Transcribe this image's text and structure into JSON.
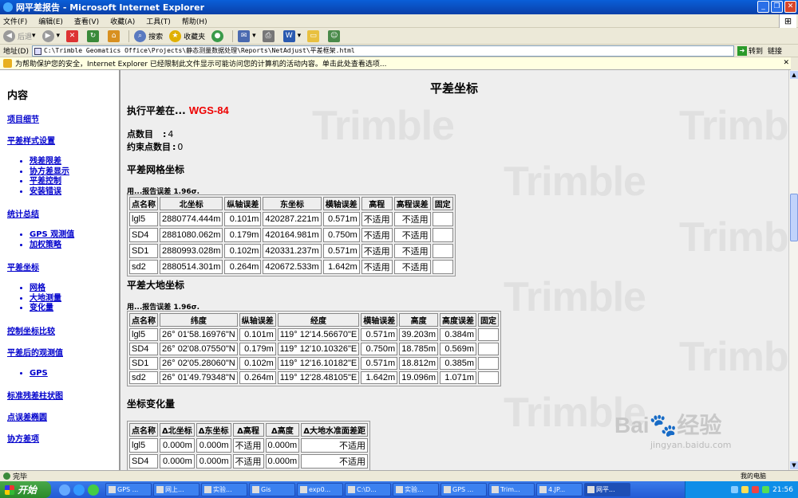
{
  "window": {
    "title": "网平差报告 - Microsoft Internet Explorer",
    "controls": {
      "minimize": "_",
      "maximize": "❐",
      "close": "✕"
    }
  },
  "menu": [
    "文件(F)",
    "编辑(E)",
    "查看(V)",
    "收藏(A)",
    "工具(T)",
    "帮助(H)"
  ],
  "toolbar": {
    "back": "后退",
    "forward": "",
    "search": "搜索",
    "favorites": "收藏夹"
  },
  "address": {
    "label": "地址(D)",
    "url": "C:\\Trimble Geomatics Office\\Projects\\静态测量数据处理\\Reports\\NetAdjust\\平差框架.html",
    "go": "转到",
    "links": "链接"
  },
  "infobar": {
    "text": "为帮助保护您的安全，Internet Explorer 已经限制此文件显示可能访问您的计算机的活动内容。单击此处查看选项..."
  },
  "sidebar": {
    "title": "内容",
    "sections": [
      {
        "label": "项目细节",
        "items": []
      },
      {
        "label": "平差样式设置",
        "items": [
          "残差限差",
          "协方差显示",
          "平差控制",
          "安装错误"
        ]
      },
      {
        "label": "统计总结",
        "items": [
          "GPS 观测值",
          "加权策略"
        ]
      },
      {
        "label": "平差坐标",
        "items": [
          "网格",
          "大地测量",
          "变化量"
        ]
      },
      {
        "label": "控制坐标比较",
        "items": []
      },
      {
        "label": "平差后的观测值",
        "items": [
          "GPS"
        ]
      },
      {
        "label": "标准残差柱状图",
        "items": []
      },
      {
        "label": "点误差椭圆",
        "items": []
      },
      {
        "label": "协方差项",
        "items": []
      }
    ]
  },
  "main": {
    "title": "平差坐标",
    "exec_label": "执行平差在...",
    "exec_datum": "WGS-84",
    "point_count_label": "点数目",
    "point_count": "4",
    "constraint_label": "约束点数目",
    "constraint_count": "0",
    "watermark": "Trimble",
    "grid": {
      "heading": "平差网格坐标",
      "note": "用...报告误差  1.96σ.",
      "columns": [
        "点名称",
        "北坐标",
        "纵轴误差",
        "东坐标",
        "横轴误差",
        "高程",
        "高程误差",
        "固定"
      ],
      "rows": [
        [
          "lgl5",
          "2880774.444m",
          "0.101m",
          "420287.221m",
          "0.571m",
          "不适用",
          "不适用",
          ""
        ],
        [
          "SD4",
          "2881080.062m",
          "0.179m",
          "420164.981m",
          "0.750m",
          "不适用",
          "不适用",
          ""
        ],
        [
          "SD1",
          "2880993.028m",
          "0.102m",
          "420331.237m",
          "0.571m",
          "不适用",
          "不适用",
          ""
        ],
        [
          "sd2",
          "2880514.301m",
          "0.264m",
          "420672.533m",
          "1.642m",
          "不适用",
          "不适用",
          ""
        ]
      ]
    },
    "geodetic": {
      "heading": "平差大地坐标",
      "note": "用...报告误差  1.96σ.",
      "columns": [
        "点名称",
        "纬度",
        "纵轴误差",
        "经度",
        "横轴误差",
        "高度",
        "高度误差",
        "固定"
      ],
      "rows": [
        [
          "lgl5",
          "26°  01'58.16976\"N",
          "0.101m",
          "119°  12'14.56670\"E",
          "0.571m",
          "39.203m",
          "0.384m",
          ""
        ],
        [
          "SD4",
          "26°  02'08.07550\"N",
          "0.179m",
          "119°  12'10.10326\"E",
          "0.750m",
          "18.785m",
          "0.569m",
          ""
        ],
        [
          "SD1",
          "26°  02'05.28060\"N",
          "0.102m",
          "119°  12'16.10182\"E",
          "0.571m",
          "18.812m",
          "0.385m",
          ""
        ],
        [
          "sd2",
          "26°  01'49.79348\"N",
          "0.264m",
          "119°  12'28.48105\"E",
          "1.642m",
          "19.096m",
          "1.071m",
          ""
        ]
      ]
    },
    "delta": {
      "heading": "坐标变化量",
      "columns": [
        "点名称",
        "Δ北坐标",
        "Δ东坐标",
        "Δ高程",
        "Δ高度",
        "Δ大地水准面差距"
      ],
      "rows": [
        [
          "lgl5",
          "0.000m",
          "0.000m",
          "不适用",
          "0.000m",
          "不适用"
        ],
        [
          "SD4",
          "0.000m",
          "0.000m",
          "不适用",
          "0.000m",
          "不适用"
        ]
      ]
    }
  },
  "status": {
    "left": "完毕",
    "right": "我的电脑"
  },
  "taskbar": {
    "start": "开始",
    "tasks": [
      "GPS ...",
      "网上...",
      "实验...",
      "Gis",
      "exp0...",
      "C:\\D...",
      "实验...",
      "GPS ...",
      "Trim...",
      "4.JP...",
      "网平..."
    ],
    "clock": "21:56"
  },
  "baidu": {
    "logo": "Bai🐾经验",
    "url": "jingyan.baidu.com"
  },
  "colors": {
    "title_blue": "#0a3fa8",
    "exec_red": "#ee0000",
    "link_blue": "#0000cc",
    "taskbar_blue": "#225ad5"
  }
}
